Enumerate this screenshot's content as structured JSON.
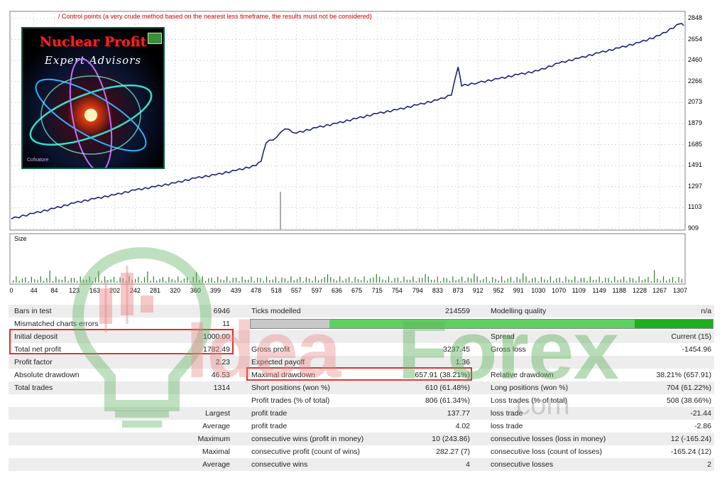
{
  "chart": {
    "note": "/ Control points (a very crude method based on the nearest less timeframe, the results must not be considered)",
    "size_label": "Size",
    "y_ticks": [
      "2848",
      "2654",
      "2460",
      "2266",
      "2073",
      "1879",
      "1685",
      "1491",
      "1297",
      "1103",
      "909"
    ],
    "x_ticks": [
      "0",
      "44",
      "84",
      "123",
      "163",
      "202",
      "242",
      "281",
      "320",
      "360",
      "399",
      "439",
      "478",
      "518",
      "557",
      "597",
      "636",
      "675",
      "715",
      "754",
      "794",
      "833",
      "873",
      "912",
      "952",
      "991",
      "1030",
      "1070",
      "1109",
      "1149",
      "1188",
      "1228",
      "1267",
      "1307"
    ],
    "line_color": "#1a237e",
    "volume_color": "#2e7d32"
  },
  "chart_data": {
    "type": "line",
    "x": [
      0,
      44,
      84,
      123,
      163,
      202,
      242,
      281,
      320,
      360,
      399,
      439,
      478,
      488,
      498,
      518,
      535,
      557,
      597,
      636,
      675,
      715,
      754,
      794,
      833,
      860,
      873,
      880,
      912,
      952,
      991,
      1030,
      1070,
      1109,
      1149,
      1188,
      1228,
      1267,
      1307,
      1314
    ],
    "values": [
      1000,
      1050,
      1095,
      1145,
      1185,
      1220,
      1265,
      1295,
      1330,
      1375,
      1405,
      1445,
      1490,
      1530,
      1700,
      1750,
      1830,
      1790,
      1840,
      1880,
      1925,
      1970,
      2005,
      2050,
      2095,
      2140,
      2400,
      2225,
      2255,
      2290,
      2330,
      2365,
      2435,
      2480,
      2530,
      2575,
      2625,
      2690,
      2800,
      2782
    ],
    "xlim": [
      0,
      1314
    ],
    "ylim": [
      909,
      2900
    ],
    "grid": true,
    "legend": "none"
  },
  "logo": {
    "title": "Nuclear Profit",
    "subtitle": "Expert Advisors",
    "brand": "Cofxatore"
  },
  "watermark": {
    "idea": "Idea",
    "forex": "Forex",
    "com": ".com"
  },
  "stats": {
    "rows": [
      {
        "l1": "Bars in test",
        "v1": "6946",
        "l2": "Ticks modelled",
        "v2": "214559",
        "l3": "Modelling quality",
        "v3": "n/a"
      },
      {
        "l1": "Mismatched charts errors",
        "v1": "11",
        "l2": "",
        "v2": "",
        "l3": "",
        "v3": ""
      },
      {
        "l1": "Initial deposit",
        "v1": "1000.00",
        "l2": "",
        "v2": "",
        "l3": "Spread",
        "v3": "Current (15)"
      },
      {
        "l1": "Total net profit",
        "v1": "1782.49",
        "l2": "Gross profit",
        "v2": "3237.45",
        "l3": "Gross loss",
        "v3": "-1454.96"
      },
      {
        "l1": "Profit factor",
        "v1": "2.23",
        "l2": "Expected payoff",
        "v2": "1.36",
        "l3": "",
        "v3": ""
      },
      {
        "l1": "Absolute drawdown",
        "v1": "46.53",
        "l2": "Maximal drawdown",
        "v2": "657.91 (38.21%)",
        "l3": "Relative drawdown",
        "v3": "38.21% (657.91)"
      },
      {
        "l1": "Total trades",
        "v1": "1314",
        "l2": "Short positions (won %)",
        "v2": "610 (61.48%)",
        "l3": "Long positions (won %)",
        "v3": "704 (61.22%)"
      },
      {
        "l1": "",
        "v1": "",
        "l2": "Profit trades (% of total)",
        "v2": "806 (61.34%)",
        "l3": "Loss trades (% of total)",
        "v3": "508 (38.66%)"
      },
      {
        "l1": "",
        "v1": "Largest",
        "l2": "profit trade",
        "v2": "137.77",
        "l3": "loss trade",
        "v3": "-21.44"
      },
      {
        "l1": "",
        "v1": "Average",
        "l2": "profit trade",
        "v2": "4.02",
        "l3": "loss trade",
        "v3": "-2.86"
      },
      {
        "l1": "",
        "v1": "Maximum",
        "l2": "consecutive wins (profit in money)",
        "v2": "10 (243.86)",
        "l3": "consecutive losses (loss in money)",
        "v3": "12 (-165.24)"
      },
      {
        "l1": "",
        "v1": "Maximal",
        "l2": "consecutive profit (count of wins)",
        "v2": "282.27 (7)",
        "l3": "consecutive loss (count of losses)",
        "v3": "-165.24 (12)"
      },
      {
        "l1": "",
        "v1": "Average",
        "l2": "consecutive wins",
        "v2": "4",
        "l3": "consecutive losses",
        "v3": "2"
      }
    ],
    "modelling_quality_bar": {
      "gray_fraction": 0.17,
      "fill_color": "#5fcf5f",
      "end_color": "#1fae1f"
    }
  }
}
